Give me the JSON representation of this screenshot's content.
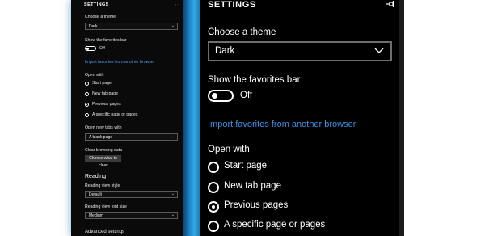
{
  "small": {
    "title": "SETTINGS",
    "pin_icon": "pin-icon",
    "theme_label": "Choose a theme",
    "theme_value": "Dark",
    "favorites_label": "Show the favorites bar",
    "favorites_state": "Off",
    "import_link": "Import favorites from another browser",
    "open_with_label": "Open with",
    "open_with_options": [
      "Start page",
      "New tab page",
      "Previous pages",
      "A specific page or pages"
    ],
    "open_with_selected": "Previous pages",
    "new_tabs_label": "Open new tabs with",
    "new_tabs_value": "A blank page",
    "clear_label": "Clear browsing data",
    "clear_button": "Choose what to clear",
    "reading_heading": "Reading",
    "reading_style_label": "Reading view style",
    "reading_style_value": "Default",
    "reading_font_label": "Reading view font size",
    "reading_font_value": "Medium",
    "advanced_heading": "Advanced settings"
  },
  "big": {
    "title": "SETTINGS",
    "pin_icon": "pin-icon",
    "theme_label": "Choose a theme",
    "theme_value": "Dark",
    "favorites_label": "Show the favorites bar",
    "favorites_state": "Off",
    "import_link": "Import favorites from another browser",
    "open_with_label": "Open with",
    "open_with_options": [
      "Start page",
      "New tab page",
      "Previous pages",
      "A specific page or pages"
    ],
    "open_with_selected": "Previous pages"
  },
  "colors": {
    "accent": "#3f8fe0",
    "panel_bg": "#000000",
    "strip_blue": "#1c86c9"
  }
}
